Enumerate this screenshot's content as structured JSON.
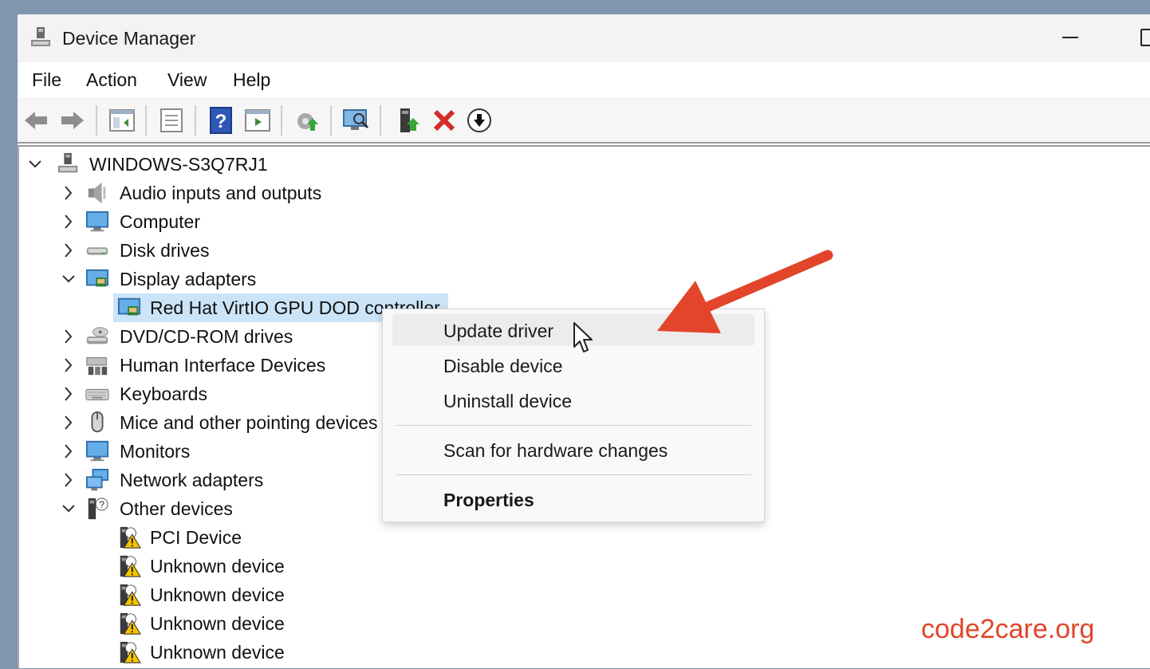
{
  "window": {
    "title": "Device Manager"
  },
  "menu": [
    "File",
    "Action",
    "View",
    "Help"
  ],
  "toolbar": {
    "icons": [
      "back-icon",
      "forward-icon",
      "show-hide-tree-icon",
      "properties-icon",
      "help-icon",
      "run-icon",
      "update-driver-icon",
      "scan-hardware-icon",
      "enable-device-icon",
      "uninstall-icon",
      "disable-device-icon"
    ]
  },
  "tree": {
    "root": "WINDOWS-S3Q7RJ1",
    "items": [
      {
        "label": "Audio inputs and outputs",
        "expanded": false,
        "icon": "speaker-icon"
      },
      {
        "label": "Computer",
        "expanded": false,
        "icon": "monitor-icon"
      },
      {
        "label": "Disk drives",
        "expanded": false,
        "icon": "disk-drive-icon"
      },
      {
        "label": "Display adapters",
        "expanded": true,
        "icon": "display-adapter-icon"
      },
      {
        "label": "Red Hat VirtIO GPU DOD controller",
        "child": true,
        "selected": true,
        "icon": "display-adapter-icon"
      },
      {
        "label": "DVD/CD-ROM drives",
        "expanded": false,
        "icon": "dvd-drive-icon"
      },
      {
        "label": "Human Interface Devices",
        "expanded": false,
        "icon": "hid-icon"
      },
      {
        "label": "Keyboards",
        "expanded": false,
        "icon": "keyboard-icon"
      },
      {
        "label": "Mice and other pointing devices",
        "expanded": false,
        "icon": "mouse-icon"
      },
      {
        "label": "Monitors",
        "expanded": false,
        "icon": "monitor-icon"
      },
      {
        "label": "Network adapters",
        "expanded": false,
        "icon": "network-adapter-icon"
      },
      {
        "label": "Other devices",
        "expanded": true,
        "icon": "unknown-device-icon"
      },
      {
        "label": "PCI Device",
        "child": true,
        "icon": "warning-device-icon"
      },
      {
        "label": "Unknown device",
        "child": true,
        "icon": "warning-device-icon"
      },
      {
        "label": "Unknown device",
        "child": true,
        "icon": "warning-device-icon"
      },
      {
        "label": "Unknown device",
        "child": true,
        "icon": "warning-device-icon"
      },
      {
        "label": "Unknown device",
        "child": true,
        "icon": "warning-device-icon"
      }
    ]
  },
  "context_menu": {
    "items": [
      {
        "label": "Update driver",
        "hovered": true,
        "bold": false
      },
      {
        "label": "Disable device",
        "bold": false
      },
      {
        "label": "Uninstall device",
        "bold": false
      },
      {
        "label": "Scan for hardware changes",
        "bold": false
      },
      {
        "label": "Properties",
        "bold": true
      }
    ]
  },
  "watermark": "code2care.org",
  "colors": {
    "selection": "#cce4f7",
    "arrow": "#e2452a",
    "watermark": "#e2452a"
  }
}
